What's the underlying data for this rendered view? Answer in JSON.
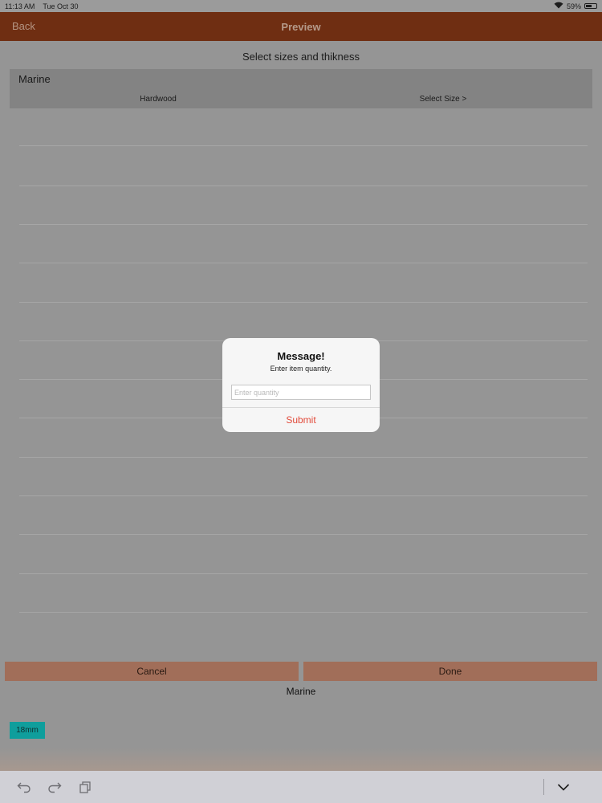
{
  "status_bar": {
    "time": "11:13 AM",
    "date": "Tue Oct 30",
    "battery": "59%",
    "battery_level": 0.59
  },
  "navbar": {
    "back_label": "Back",
    "title": "Preview"
  },
  "main": {
    "subtitle": "Select sizes and thikness",
    "category": "Marine",
    "columns": [
      "Hardwood",
      "Select Size >"
    ]
  },
  "buttons": {
    "cancel": "Cancel",
    "done": "Done"
  },
  "section_label": "Marine",
  "chip": "18mm",
  "dialog": {
    "title": "Message!",
    "message": "Enter item quantity.",
    "input_value": "",
    "input_placeholder": "Enter quantity",
    "submit_label": "Submit"
  },
  "toolbar": {
    "icons": [
      "undo-icon",
      "redo-icon",
      "copy-icon",
      "chevron-down-icon"
    ]
  },
  "colors": {
    "nav": "#6f2e12",
    "accent_red": "#e24b3b",
    "chip": "#0f9e9c"
  }
}
